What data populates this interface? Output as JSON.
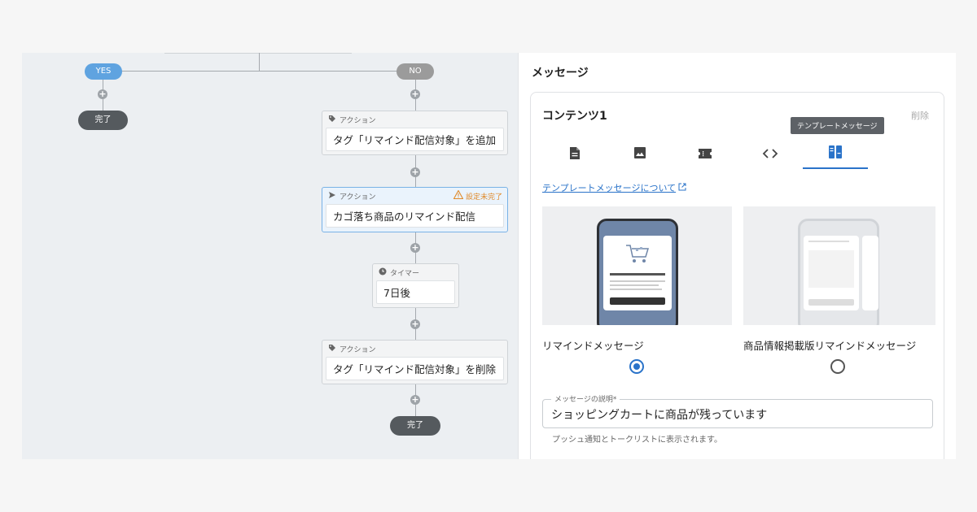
{
  "flow": {
    "branch_yes": "YES",
    "branch_no": "NO",
    "done_left": "完了",
    "done_right": "完了",
    "nodes": [
      {
        "type_label": "アクション",
        "text": "タグ「リマインド配信対象」を追加"
      },
      {
        "type_label": "アクション",
        "text": "カゴ落ち商品のリマインド配信",
        "warning": "設定未完了"
      },
      {
        "type_label": "タイマー",
        "text": "7日後"
      },
      {
        "type_label": "アクション",
        "text": "タグ「リマインド配信対象」を削除"
      }
    ]
  },
  "panel": {
    "title": "メッセージ",
    "card_title": "コンテンツ1",
    "delete_label": "削除",
    "tooltip": "テンプレートメッセージ",
    "tabs": [
      {
        "icon": "document-icon"
      },
      {
        "icon": "image-icon"
      },
      {
        "icon": "ticket-icon"
      },
      {
        "icon": "code-icon"
      },
      {
        "icon": "template-icon",
        "active": true
      }
    ],
    "template_link": "テンプレートメッセージについて",
    "templates": [
      {
        "label": "リマインドメッセージ",
        "selected": true
      },
      {
        "label": "商品情報掲載版リマインドメッセージ",
        "selected": false
      }
    ],
    "description_field": {
      "label": "メッセージの説明*",
      "value": "ショッピングカートに商品が残っています"
    },
    "hint": "プッシュ通知とトークリストに表示されます。"
  },
  "colors": {
    "accent": "#2a73c9",
    "yes_pill": "#5fa3e0",
    "warning": "#e08a2a",
    "done_pill": "#555a5e"
  }
}
